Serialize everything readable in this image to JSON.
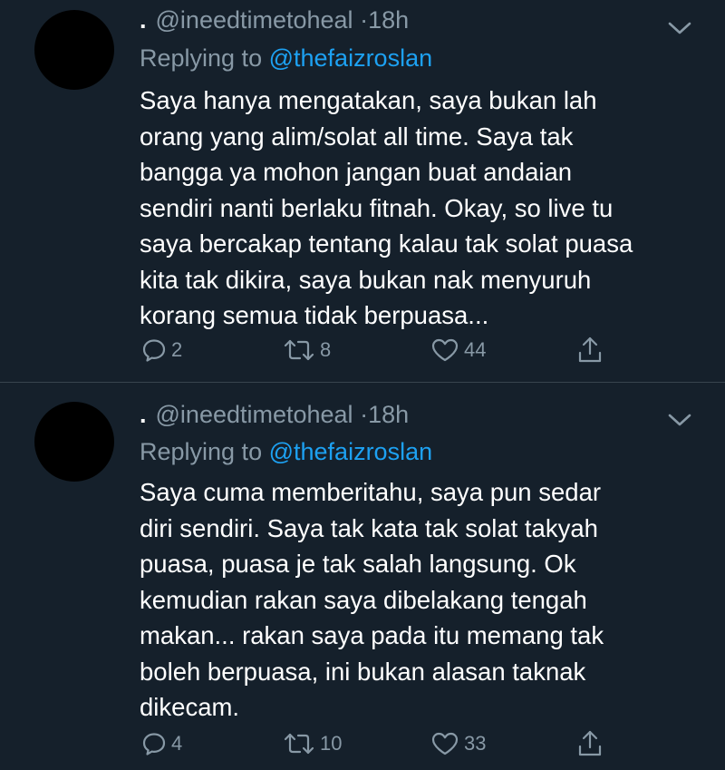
{
  "tweets": [
    {
      "dot": ".",
      "handle": "@ineedtimetoheal",
      "time_sep": "·",
      "time": "18h",
      "replying_prefix": "Replying to",
      "replying_to": "@thefaizroslan",
      "lines": [
        "Saya hanya mengatakan, saya bukan lah",
        "orang yang alim/solat all time. Saya tak",
        "bangga ya mohon jangan buat andaian",
        "sendiri nanti berlaku fitnah. Okay, so live tu",
        "saya bercakap tentang kalau tak solat puasa",
        "kita tak dikira, saya bukan nak menyuruh",
        "korang semua tidak berpuasa..."
      ],
      "replies": "2",
      "retweets": "8",
      "likes": "44"
    },
    {
      "dot": ".",
      "handle": "@ineedtimetoheal",
      "time_sep": "·",
      "time": "18h",
      "replying_prefix": "Replying to",
      "replying_to": "@thefaizroslan",
      "lines": [
        "Saya cuma memberitahu, saya pun sedar",
        "diri sendiri. Saya tak kata tak solat takyah",
        "puasa, puasa je tak salah langsung. Ok",
        "kemudian rakan saya dibelakang tengah",
        "makan... rakan saya pada itu memang tak",
        "boleh berpuasa, ini bukan alasan taknak",
        "dikecam."
      ],
      "replies": "4",
      "retweets": "10",
      "likes": "33"
    }
  ],
  "icons": {
    "reply": "reply-icon",
    "retweet": "retweet-icon",
    "like": "heart-icon",
    "share": "share-icon",
    "menu": "chevron-down-icon"
  },
  "colors": {
    "background": "#15202b",
    "secondary_text": "#8899a6",
    "link": "#1da1f2",
    "divider": "#38444d",
    "text": "#ffffff"
  }
}
